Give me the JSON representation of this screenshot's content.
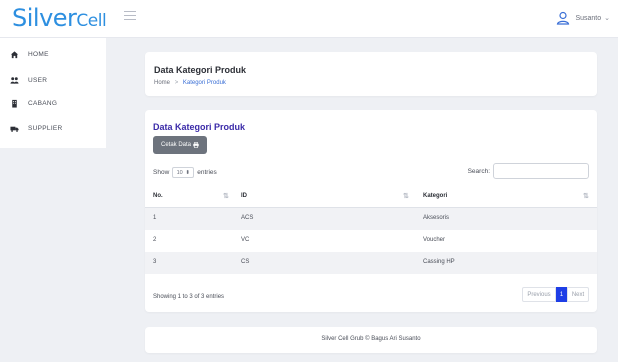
{
  "app": {
    "logo_main": "Silver",
    "logo_small": "Cell",
    "user_name": "Susanto"
  },
  "sidebar": {
    "items": [
      {
        "label": "HOME",
        "icon": "home-icon"
      },
      {
        "label": "USER",
        "icon": "users-icon"
      },
      {
        "label": "CABANG",
        "icon": "building-icon"
      },
      {
        "label": "SUPPLIER",
        "icon": "truck-icon"
      }
    ]
  },
  "header": {
    "title": "Data Kategori Produk",
    "breadcrumb_home": "Home",
    "breadcrumb_sep": ">",
    "breadcrumb_current": "Kategori Produk"
  },
  "content": {
    "title": "Data Kategori Produk",
    "print_button": "Cetak Data",
    "show_label": "Show",
    "entries_value": "10",
    "entries_label": "entries",
    "search_label": "Search:",
    "columns": [
      "No.",
      "ID",
      "Kategori"
    ],
    "rows": [
      {
        "no": "1",
        "id": "ACS",
        "kategori": "Aksesoris"
      },
      {
        "no": "2",
        "id": "VC",
        "kategori": "Voucher"
      },
      {
        "no": "3",
        "id": "CS",
        "kategori": "Cassing HP"
      }
    ],
    "info": "Showing 1 to 3 of 3 entries",
    "pager": {
      "previous": "Previous",
      "current": "1",
      "next": "Next"
    }
  },
  "footer": {
    "text": "Silver Cell Grub © Bagus Ari Susanto"
  },
  "colors": {
    "logo": "#2d8fe0",
    "section_title": "#3a2aa8",
    "pager_active": "#1e3ee6",
    "print_button": "#6d737d"
  }
}
